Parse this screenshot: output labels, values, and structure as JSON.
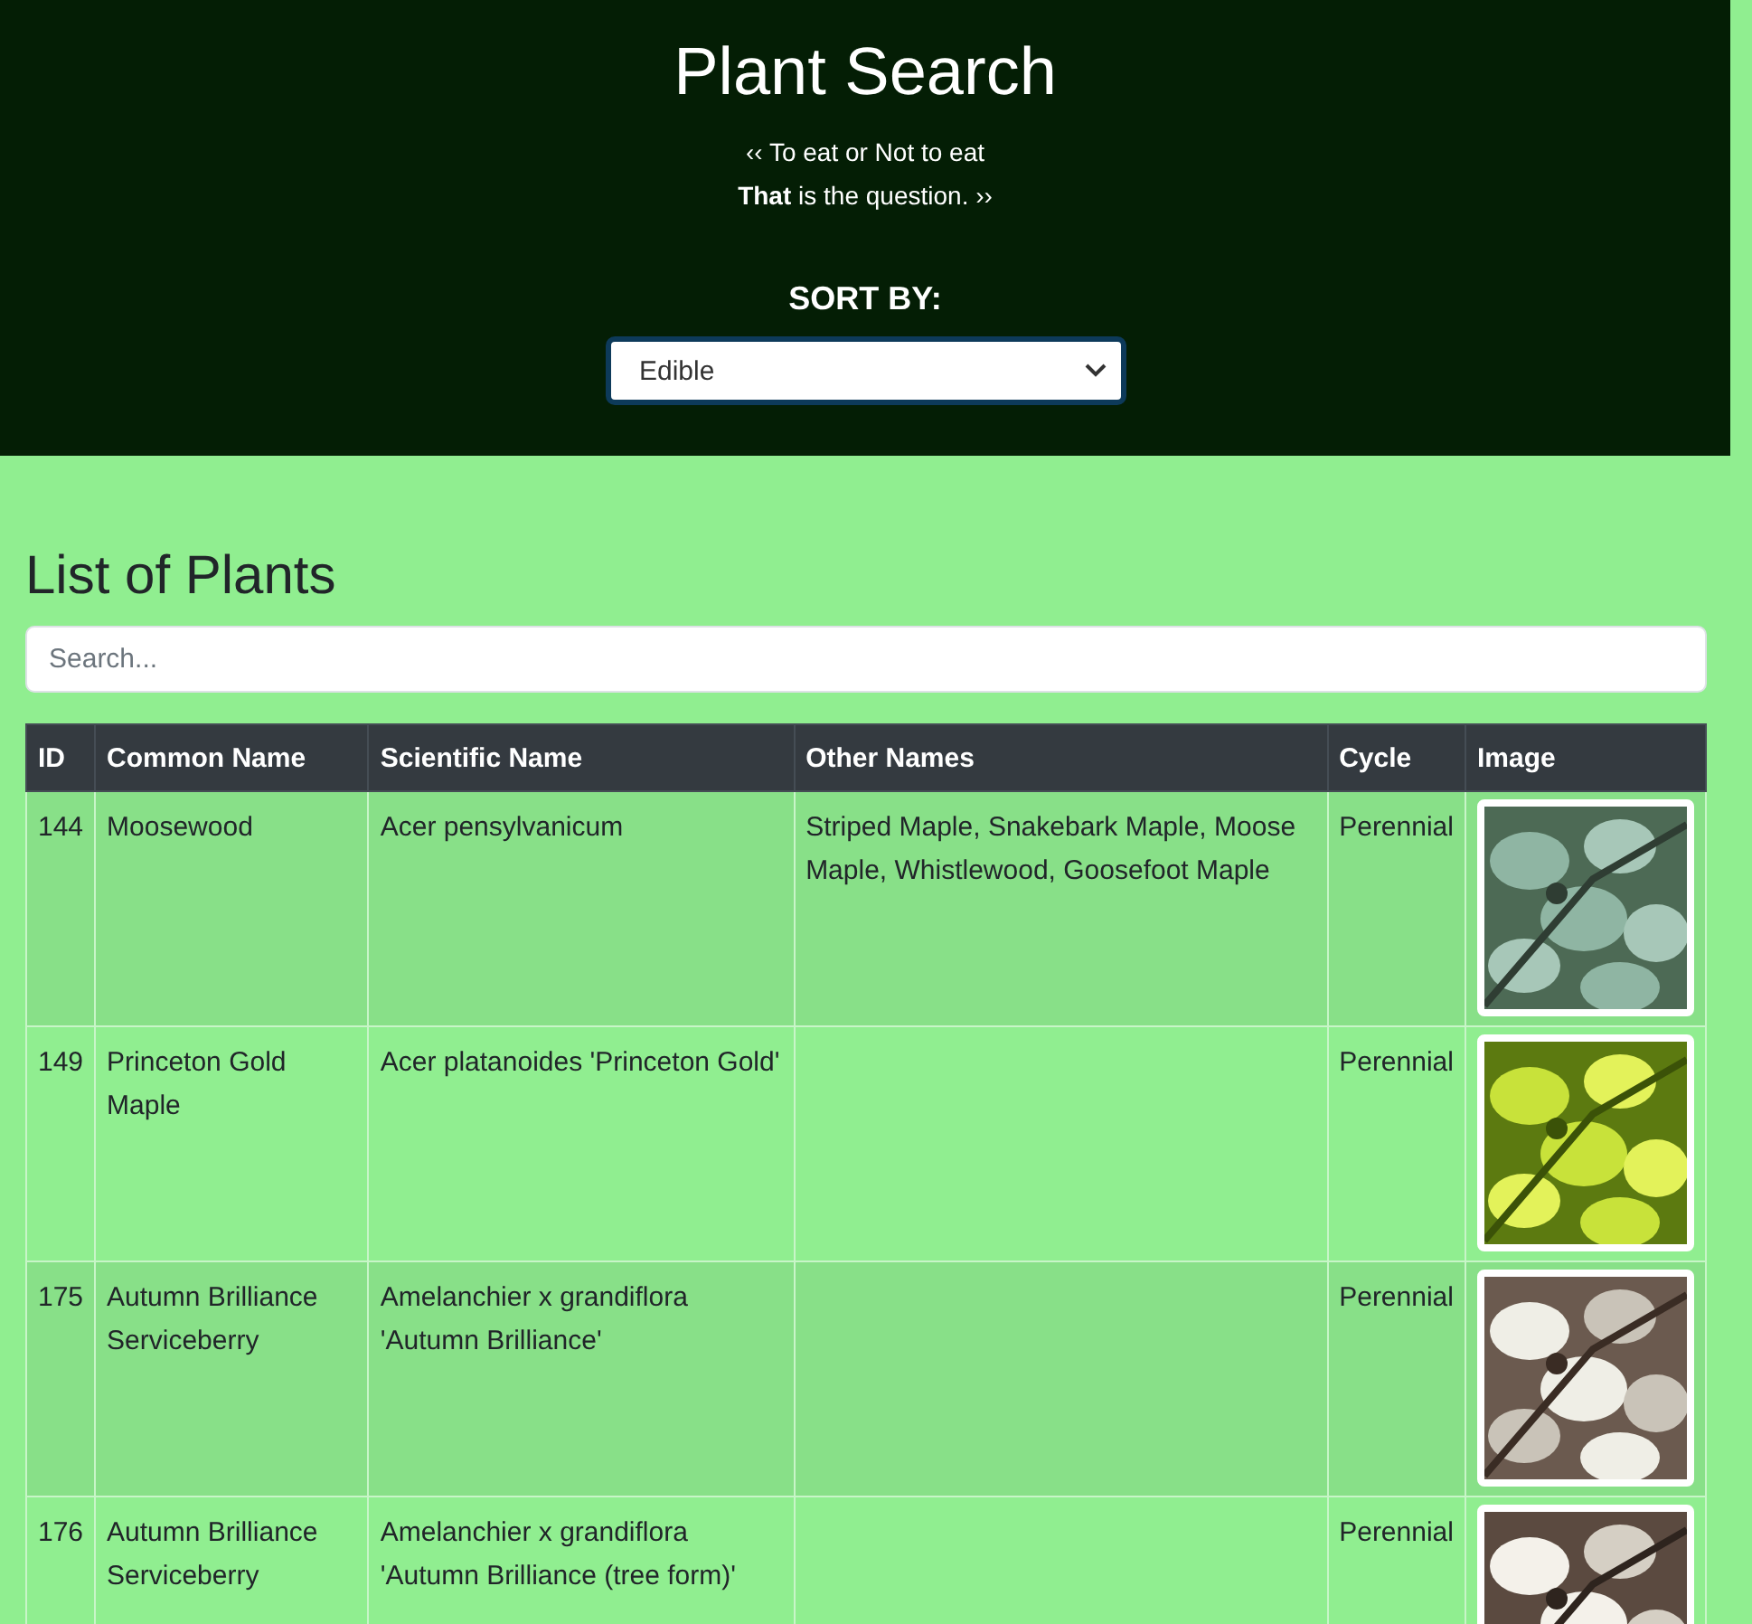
{
  "header": {
    "title": "Plant Search",
    "quote_lines": [
      "‹‹ To eat or Not to eat",
      "**That**  is the question. ››"
    ],
    "sort_label": "SORT BY:",
    "sort_select": {
      "value": "Edible"
    }
  },
  "list": {
    "heading": "List of Plants",
    "search": {
      "placeholder": "Search..."
    },
    "table": {
      "columns": [
        "ID",
        "Common Name",
        "Scientific Name",
        "Other Names",
        "Cycle",
        "Image"
      ],
      "rows": [
        {
          "id": "144",
          "common_name": "Moosewood",
          "scientific_name": "Acer pensylvanicum",
          "other_names": "Striped Maple, Snakebark Maple, Moose Maple, Whistlewood, Goosefoot Maple",
          "cycle": "Perennial"
        },
        {
          "id": "149",
          "common_name": "Princeton Gold Maple",
          "scientific_name": "Acer platanoides 'Princeton Gold'",
          "cycle": "Perennial"
        },
        {
          "id": "175",
          "common_name": "Autumn Brilliance Serviceberry",
          "scientific_name": "Amelanchier x grandiflora 'Autumn Brilliance'",
          "cycle": "Perennial"
        },
        {
          "id": "176",
          "common_name": "Autumn Brilliance Serviceberry",
          "scientific_name": "Amelanchier x grandiflora 'Autumn Brilliance (tree form)'",
          "cycle": "Perennial"
        }
      ]
    }
  }
}
